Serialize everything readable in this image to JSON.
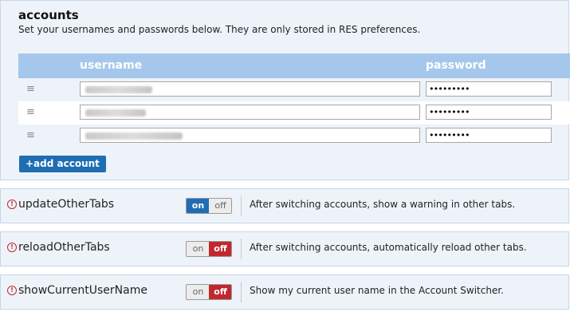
{
  "accounts": {
    "title": "accounts",
    "description": "Set your usernames and passwords below. They are only stored in RES preferences.",
    "columns": {
      "username": "username",
      "password": "password"
    },
    "rows": [
      {
        "password_mask": "•••••••••"
      },
      {
        "password_mask": "•••••••••"
      },
      {
        "password_mask": "•••••••••"
      }
    ],
    "add_button_label": "+add account"
  },
  "options": [
    {
      "name": "updateOtherTabs",
      "state": "on",
      "on_label": "on",
      "off_label": "off",
      "description": "After switching accounts, show a warning in other tabs."
    },
    {
      "name": "reloadOtherTabs",
      "state": "off",
      "on_label": "on",
      "off_label": "off",
      "description": "After switching accounts, automatically reload other tabs."
    },
    {
      "name": "showCurrentUserName",
      "state": "off",
      "on_label": "on",
      "off_label": "off",
      "description": "Show my current user name in the Account Switcher."
    }
  ],
  "colors": {
    "accent_blue": "#1f6db2",
    "off_red": "#c0282d",
    "header_blue": "#a6c7ec",
    "panel_bg": "#eef3fa"
  },
  "icons": {
    "warning": "exclamation-circle-icon",
    "drag": "drag-handle-icon"
  }
}
